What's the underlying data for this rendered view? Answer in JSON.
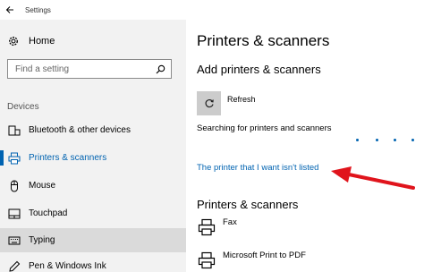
{
  "window": {
    "title": "Settings"
  },
  "sidebar": {
    "home_label": "Home",
    "search_placeholder": "Find a setting",
    "section_label": "Devices",
    "items": [
      {
        "label": "Bluetooth & other devices",
        "icon": "bluetooth-icon"
      },
      {
        "label": "Printers & scanners",
        "icon": "printer-icon",
        "selected": true
      },
      {
        "label": "Mouse",
        "icon": "mouse-icon"
      },
      {
        "label": "Touchpad",
        "icon": "touchpad-icon"
      },
      {
        "label": "Typing",
        "icon": "keyboard-icon",
        "hovered": true
      },
      {
        "label": "Pen & Windows Ink",
        "icon": "pen-icon"
      }
    ]
  },
  "main": {
    "title": "Printers & scanners",
    "add_heading": "Add printers & scanners",
    "refresh_label": "Refresh",
    "searching_text": "Searching for printers and scanners",
    "not_listed_link": "The printer that I want isn't listed",
    "list_heading": "Printers & scanners",
    "printers": [
      {
        "name": "Fax",
        "icon": "fax-icon"
      },
      {
        "name": "Microsoft Print to PDF",
        "icon": "pdf-printer-icon"
      }
    ]
  },
  "colors": {
    "accent": "#0063b1",
    "sidebar_bg": "#f2f2f2",
    "annotation_arrow": "#e0141c",
    "refresh_tile": "#cccccc"
  }
}
